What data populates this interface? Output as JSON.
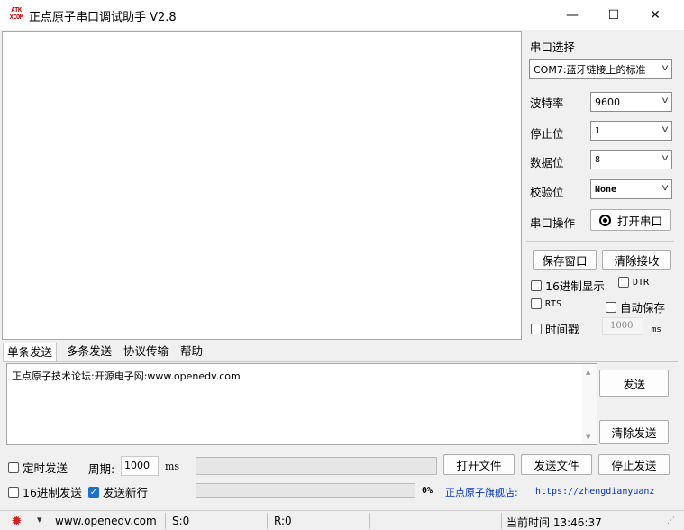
{
  "window": {
    "icon_text": "ATK\nXCOM",
    "title": "正点原子串口调试助手 V2.8",
    "controls": {
      "minimize": "—",
      "maximize": "☐",
      "close": "✕"
    }
  },
  "settings": {
    "port_label": "串口选择",
    "port_value": "COM7:蓝牙链接上的标准",
    "baud_label": "波特率",
    "baud_value": "9600",
    "stop_label": "停止位",
    "stop_value": "1",
    "data_label": "数据位",
    "data_value": "8",
    "parity_label": "校验位",
    "parity_value": "None",
    "op_label": "串口操作",
    "open_button": "打开串口",
    "save_window": "保存窗口",
    "clear_recv": "清除接收",
    "hex_display": "16进制显示",
    "dtr": "DTR",
    "rts": "RTS",
    "auto_save": "自动保存",
    "timestamp": "时间戳",
    "timestamp_value": "1000",
    "timestamp_unit": "ms"
  },
  "tabs": [
    "单条发送",
    "多条发送",
    "协议传输",
    "帮助"
  ],
  "send": {
    "text": "正点原子技术论坛:开源电子网:www.openedv.com",
    "send_button": "发送",
    "clear_send_button": "清除发送"
  },
  "bottom": {
    "timed_send": "定时发送",
    "period_label": "周期:",
    "period_value": "1000",
    "period_unit": "ms",
    "open_file": "打开文件",
    "send_file": "发送文件",
    "stop_send": "停止发送",
    "hex_send": "16进制发送",
    "send_newline": "发送新行",
    "progress_percent": "0%",
    "progress_value": 0,
    "shop_label": "正点原子旗舰店:",
    "shop_url": "https://zhengdianyuanz"
  },
  "status": {
    "dropdown": "▾",
    "website": "www.openedv.com",
    "sent": "S:0",
    "received": "R:0",
    "time": "当前时间 13:46:37"
  }
}
